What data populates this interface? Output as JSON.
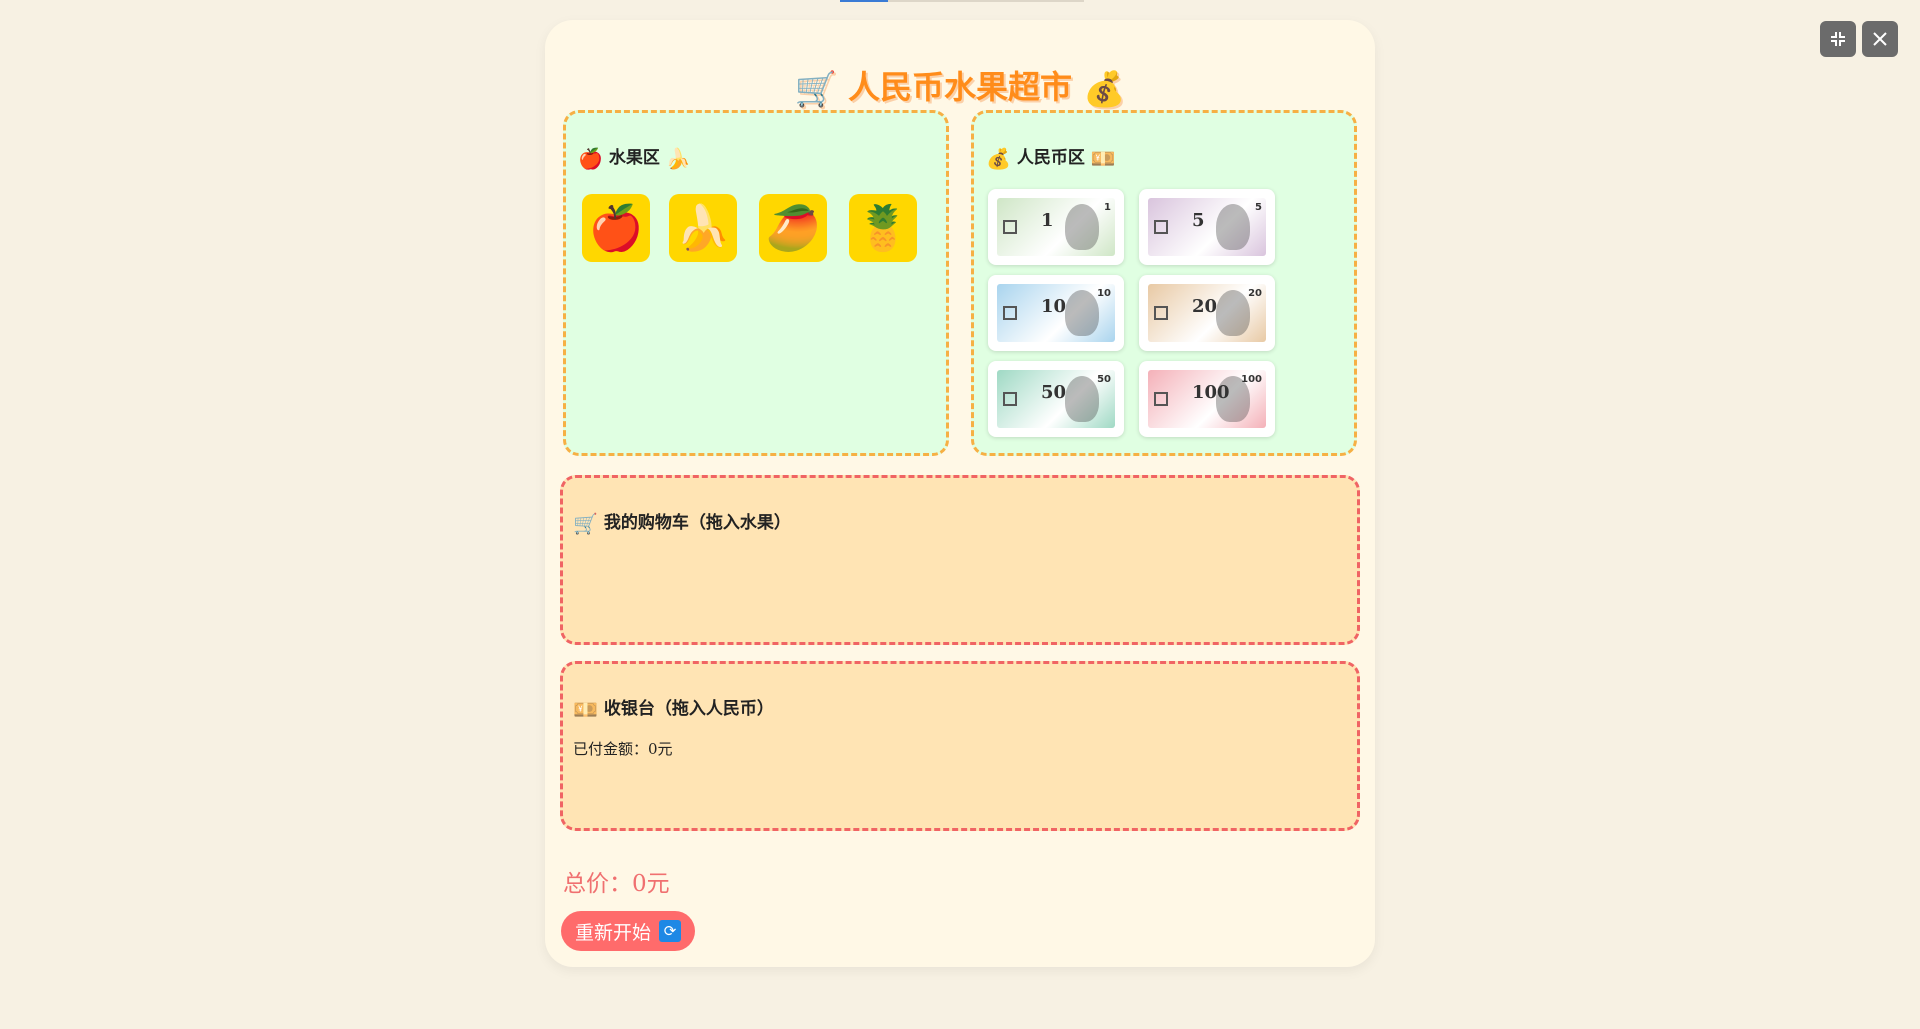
{
  "title": {
    "icon_left": "🛒",
    "text": "人民币水果超市",
    "icon_right": "💰"
  },
  "fruit_zone": {
    "icon_left": "🍎",
    "label": "水果区",
    "icon_right": "🍌",
    "fruits": [
      "🍎",
      "🍌",
      "🥭",
      "🍍"
    ]
  },
  "money_zone": {
    "icon_left": "💰",
    "label": "人民币区",
    "icon_right": "💴",
    "notes": [
      {
        "value": "1",
        "color": "#cfe6c6"
      },
      {
        "value": "5",
        "color": "#d9c4dd"
      },
      {
        "value": "10",
        "color": "#a9d4ee"
      },
      {
        "value": "20",
        "color": "#e8c9a4"
      },
      {
        "value": "50",
        "color": "#9fd9c4"
      },
      {
        "value": "100",
        "color": "#f4b0b8"
      }
    ]
  },
  "cart": {
    "icon": "🛒",
    "label": "我的购物车（拖入水果）"
  },
  "cashier": {
    "icon": "💴",
    "label": "收银台（拖入人民币）",
    "paid_label": "已付金额：0元"
  },
  "total": "总价：0元",
  "reset_button": {
    "label": "重新开始",
    "icon": "🔄"
  },
  "window_controls": {
    "exit_fullscreen_icon": "exit-fullscreen-icon",
    "close_icon": "close-icon"
  }
}
